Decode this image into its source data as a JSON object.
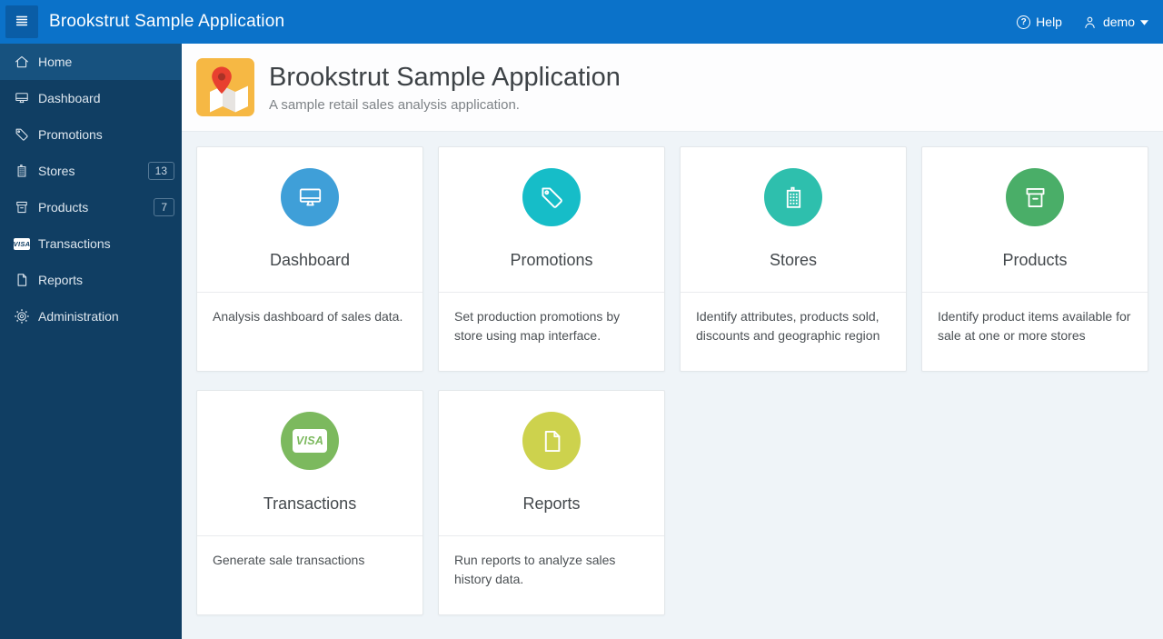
{
  "colors": {
    "header_blue": "#0b72c9",
    "header_btn": "#0a5da6",
    "sidebar_navy": "#103e63",
    "sidebar_active": "#17527f",
    "app_icon_orange": "#f6b844"
  },
  "header": {
    "title": "Brookstrut Sample Application",
    "help_label": "Help",
    "user_label": "demo"
  },
  "sidebar": {
    "items": [
      {
        "label": "Home",
        "icon": "home",
        "active": true
      },
      {
        "label": "Dashboard",
        "icon": "desktop"
      },
      {
        "label": "Promotions",
        "icon": "tag"
      },
      {
        "label": "Stores",
        "icon": "building",
        "badge": "13"
      },
      {
        "label": "Products",
        "icon": "archive",
        "badge": "7"
      },
      {
        "label": "Transactions",
        "icon": "visa"
      },
      {
        "label": "Reports",
        "icon": "document"
      },
      {
        "label": "Administration",
        "icon": "gear"
      }
    ]
  },
  "hero": {
    "title": "Brookstrut Sample Application",
    "subtitle": "A sample retail sales analysis application."
  },
  "cards": [
    {
      "title": "Dashboard",
      "icon": "desktop",
      "color": "#3f9fd8",
      "description": "Analysis dashboard of sales data."
    },
    {
      "title": "Promotions",
      "icon": "tag",
      "color": "#16bdc8",
      "description": "Set production promotions by store using map interface."
    },
    {
      "title": "Stores",
      "icon": "building",
      "color": "#2ebfad",
      "description": "Identify attributes, products sold, discounts and geographic region"
    },
    {
      "title": "Products",
      "icon": "archive",
      "color": "#4aae68",
      "description": "Identify product items available for sale at one or more stores"
    },
    {
      "title": "Transactions",
      "icon": "visa",
      "color": "#7cb95e",
      "description": "Generate sale transactions"
    },
    {
      "title": "Reports",
      "icon": "document",
      "color": "#cdd24d",
      "description": "Run reports to analyze sales history data."
    }
  ]
}
